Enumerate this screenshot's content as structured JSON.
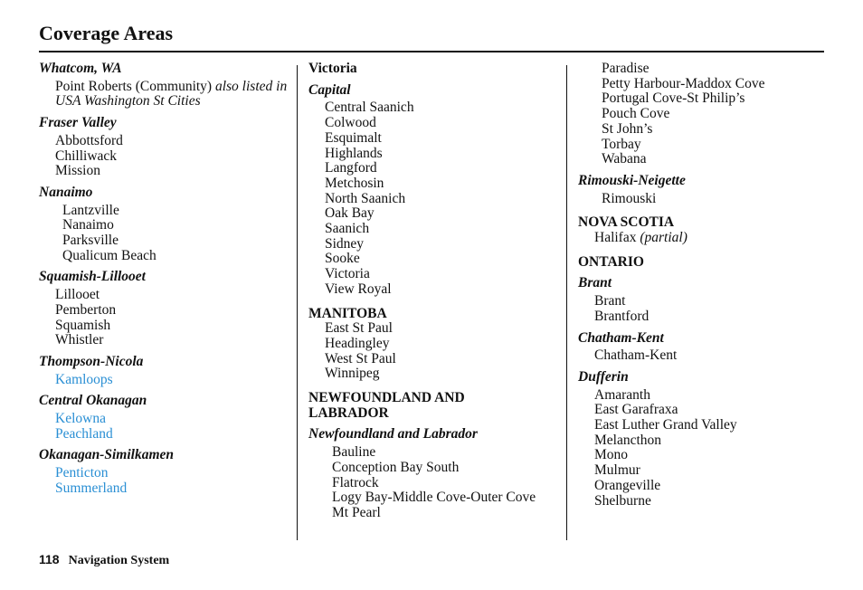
{
  "page": {
    "title": "Coverage Areas",
    "page_number": "118",
    "section_name": "Navigation System"
  },
  "colors": {
    "link": "#2a8fd4",
    "text": "#111111"
  },
  "column1": {
    "whatcom": {
      "region": "Whatcom, WA",
      "item_text": "Point Roberts (Community)",
      "item_note": "also listed in USA Washington St Cities"
    },
    "fraser_valley": {
      "region": "Fraser Valley",
      "items": [
        "Abbottsford",
        "Chilliwack",
        "Mission"
      ]
    },
    "nanaimo": {
      "region": "Nanaimo",
      "items": [
        "Lantzville",
        "Nanaimo",
        "Parksville",
        "Qualicum Beach"
      ]
    },
    "squamish": {
      "region": "Squamish-Lillooet",
      "items": [
        "Lillooet",
        "Pemberton",
        "Squamish",
        "Whistler"
      ]
    },
    "thompson": {
      "region": "Thompson-Nicola",
      "items": [
        "Kamloops"
      ]
    },
    "central_okanagan": {
      "region": "Central Okanagan",
      "items": [
        "Kelowna",
        "Peachland"
      ]
    },
    "okanagan_similkamen": {
      "region": "Okanagan-Similkamen",
      "items": [
        "Penticton",
        "Summerland"
      ]
    }
  },
  "column2": {
    "victoria": {
      "heading": "Victoria",
      "region": "Capital",
      "items": [
        "Central Saanich",
        "Colwood",
        "Esquimalt",
        "Highlands",
        "Langford",
        "Metchosin",
        "North Saanich",
        "Oak Bay",
        "Saanich",
        "Sidney",
        "Sooke",
        "Victoria",
        "View Royal"
      ]
    },
    "manitoba": {
      "province": "MANITOBA",
      "items": [
        "East St Paul",
        "Headingley",
        "West St Paul",
        "Winnipeg"
      ]
    },
    "newfoundland": {
      "province": "NEWFOUNDLAND AND LABRADOR",
      "region": "Newfoundland and Labrador",
      "items": [
        "Bauline",
        "Conception Bay South",
        "Flatrock",
        "Logy Bay-Middle Cove-Outer Cove",
        "Mt Pearl"
      ]
    }
  },
  "column3": {
    "newfoundland_cont": {
      "items": [
        "Paradise",
        "Petty Harbour-Maddox Cove",
        "Portugal Cove-St Philip’s",
        "Pouch Cove",
        "St John’s",
        "Torbay",
        "Wabana"
      ]
    },
    "rimouski": {
      "region": "Rimouski-Neigette",
      "items": [
        "Rimouski"
      ]
    },
    "nova_scotia": {
      "province": "NOVA SCOTIA",
      "item_text": "Halifax",
      "item_note": "(partial)"
    },
    "ontario": {
      "province": "ONTARIO",
      "brant": {
        "region": "Brant",
        "items": [
          "Brant",
          "Brantford"
        ]
      },
      "chatham": {
        "region": "Chatham-Kent",
        "items": [
          "Chatham-Kent"
        ]
      },
      "dufferin": {
        "region": "Dufferin",
        "items": [
          "Amaranth",
          "East Garafraxa",
          "East Luther Grand Valley",
          "Melancthon",
          "Mono",
          "Mulmur",
          "Orangeville",
          "Shelburne"
        ]
      }
    }
  }
}
